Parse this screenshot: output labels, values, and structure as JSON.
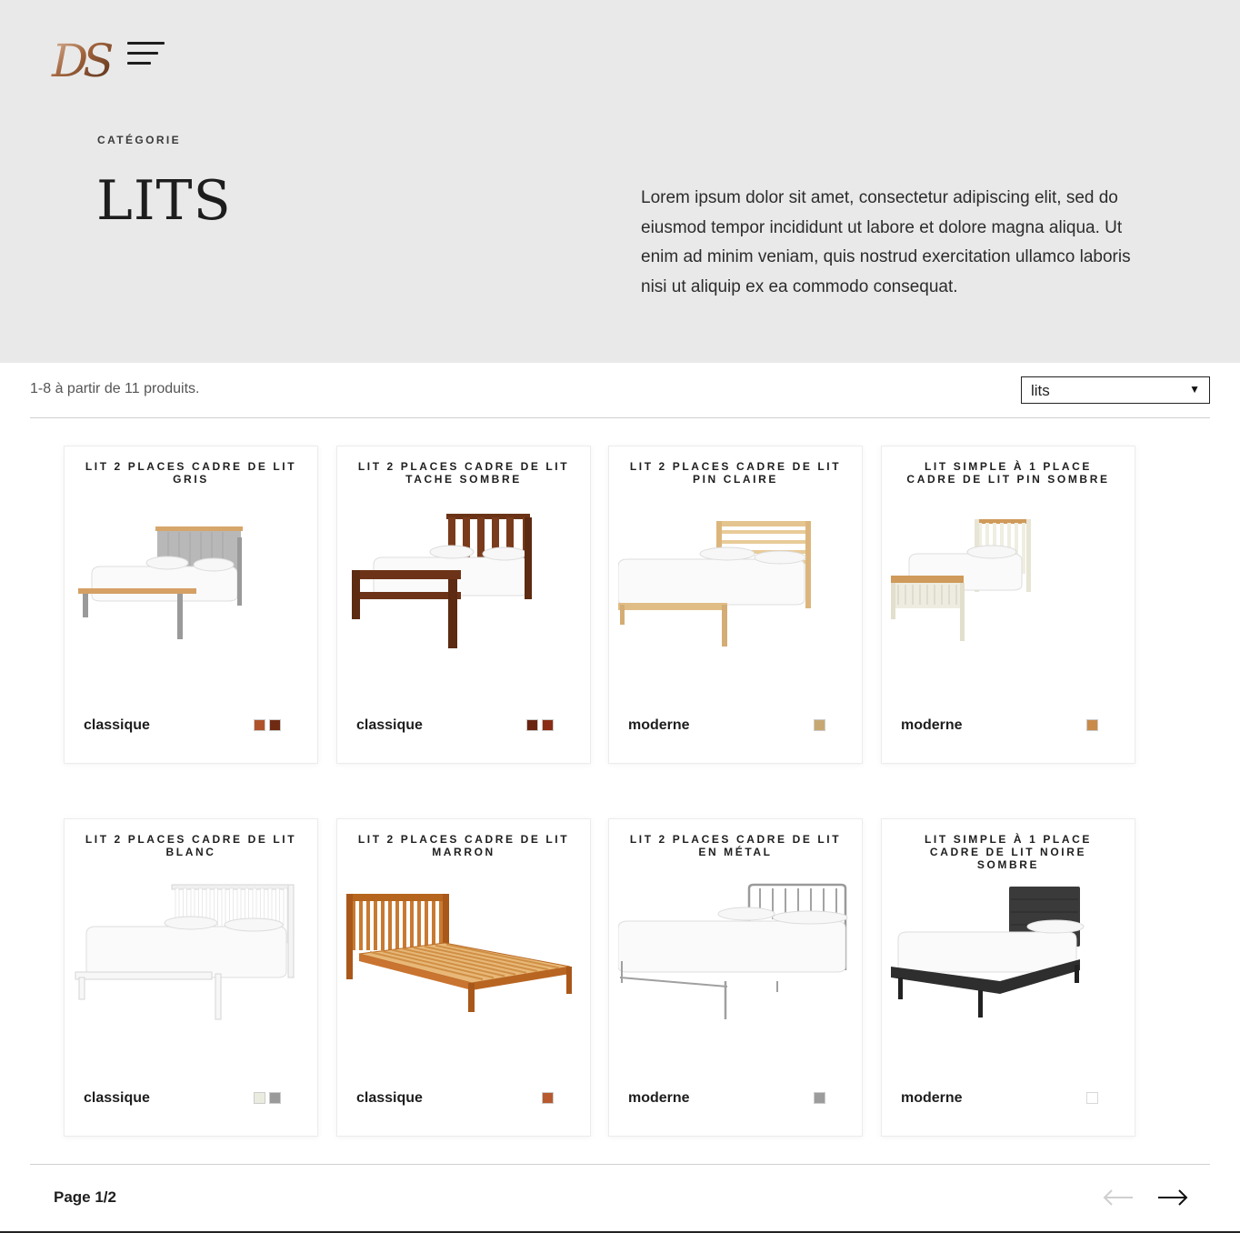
{
  "brand": {
    "logo_text": "DS",
    "icon": "menu-icon"
  },
  "hero": {
    "eyebrow": "CATÉGORIE",
    "title": "LITS",
    "description": "Lorem ipsum dolor sit amet, consectetur adipiscing elit, sed do eiusmod tempor incididunt ut labore et dolore magna aliqua. Ut enim ad minim veniam, quis nostrud exercitation ullamco laboris nisi ut aliquip ex ea commodo consequat."
  },
  "toolbar": {
    "results_text": "1-8 à partir de 11 produits.",
    "category_select": {
      "value": "lits",
      "icon": "caret-down-icon"
    }
  },
  "products": [
    {
      "title": "LIT 2 PLACES CADRE DE LIT GRIS",
      "style": "classique",
      "swatches": [
        "#b0532b",
        "#6f2a12"
      ],
      "bed_type": "grey-double"
    },
    {
      "title": "LIT 2 PLACES CADRE DE LIT TACHE SOMBRE",
      "style": "classique",
      "swatches": [
        "#6b2410",
        "#8a2d14"
      ],
      "bed_type": "dark-double"
    },
    {
      "title": "LIT 2 PLACES CADRE DE LIT PIN CLAIRE",
      "style": "moderne",
      "swatches": [
        "#c7a872"
      ],
      "bed_type": "pine-double"
    },
    {
      "title": "LIT SIMPLE À 1 PLACE CADRE DE LIT PIN SOMBRE",
      "style": "moderne",
      "swatches": [
        "#c98a4a"
      ],
      "bed_type": "cream-single"
    },
    {
      "title": "LIT 2 PLACES CADRE DE LIT BLANC",
      "style": "classique",
      "swatches": [
        "#e9ecdf",
        "#9a9a9a"
      ],
      "bed_type": "white-double"
    },
    {
      "title": "LIT 2 PLACES CADRE DE LIT MARRON",
      "style": "classique",
      "swatches": [
        "#b85a2e"
      ],
      "bed_type": "oak-double"
    },
    {
      "title": "LIT 2 PLACES CADRE DE LIT EN MÉTAL",
      "style": "moderne",
      "swatches": [
        "#9c9c9c"
      ],
      "bed_type": "metal-double"
    },
    {
      "title": "LIT SIMPLE À 1 PLACE CADRE DE LIT NOIRE SOMBRE",
      "style": "moderne",
      "swatches": [
        "#ffffff"
      ],
      "bed_type": "black-single"
    }
  ],
  "pagination": {
    "label": "Page 1/2",
    "prev_icon": "arrow-left-icon",
    "next_icon": "arrow-right-icon"
  },
  "colors": {
    "hero_bg": "#e9e9e9",
    "text": "#1e1e1e",
    "logo_gradient": [
      "#c79a7a",
      "#6b3a22"
    ]
  }
}
